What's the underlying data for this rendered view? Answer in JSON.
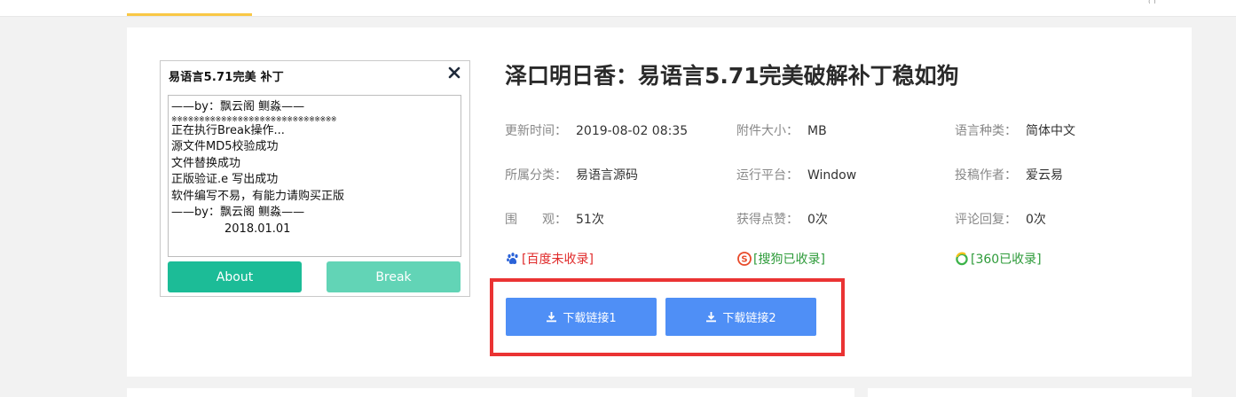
{
  "colors": {
    "page_bg": "#f2f2f2",
    "accent_line": "#f9c845",
    "download_button": "#4f8ff6",
    "highlight_box": "#ea3333",
    "dialog_about_button": "#1cbc97",
    "dialog_break_button": "#62d4b6",
    "status_not_indexed": "#e02a2a",
    "status_indexed": "#2e9b3a"
  },
  "topbar": {
    "corner_text": "( )"
  },
  "preview": {
    "title": "易语言5.71完美 补丁",
    "close_icon": "close-icon",
    "lines": [
      {
        "text": "——by：飘云阁 鲗淼——",
        "style": "normal"
      },
      {
        "text": "※※※※※※※※※※※※※※※※※※※※※※※※※※※※※※",
        "style": "dashes"
      },
      {
        "text": "正在执行Break操作...",
        "style": "normal"
      },
      {
        "text": "源文件MD5校验成功",
        "style": "normal"
      },
      {
        "text": "文件替换成功",
        "style": "normal"
      },
      {
        "text": "正版验证.e 写出成功",
        "style": "normal"
      },
      {
        "text": "软件编写不易，有能力请购买正版",
        "style": "normal"
      },
      {
        "text": "——by：飘云阁 鲗淼——",
        "style": "normal"
      },
      {
        "text": "2018.01.01",
        "style": "center"
      }
    ],
    "about_label": "About",
    "break_label": "Break"
  },
  "article": {
    "title": "泽口明日香：易语言5.71完美破解补丁稳如狗",
    "meta": [
      {
        "label": "更新时间：",
        "value": "2019-08-02 08:35"
      },
      {
        "label": "附件大小：",
        "value": "MB"
      },
      {
        "label": "语言种类：",
        "value": "简体中文"
      },
      {
        "label": "所属分类：",
        "value": "易语言源码"
      },
      {
        "label": "运行平台：",
        "value": "Window"
      },
      {
        "label": "投稿作者：",
        "value": "爱云易"
      },
      {
        "label": "围　　观：",
        "value": "51次"
      },
      {
        "label": "获得点赞：",
        "value": "0次"
      },
      {
        "label": "评论回复：",
        "value": "0次"
      }
    ],
    "index_status": [
      {
        "icon": "baidu-paw-icon",
        "text": "[百度未收录]"
      },
      {
        "icon": "sogou-icon",
        "text": "[搜狗已收录]"
      },
      {
        "icon": "360-icon",
        "text": "[360已收录]"
      }
    ]
  },
  "downloads": {
    "icon": "download-icon",
    "buttons": [
      {
        "label": "下载链接1"
      },
      {
        "label": "下载链接2"
      }
    ]
  }
}
